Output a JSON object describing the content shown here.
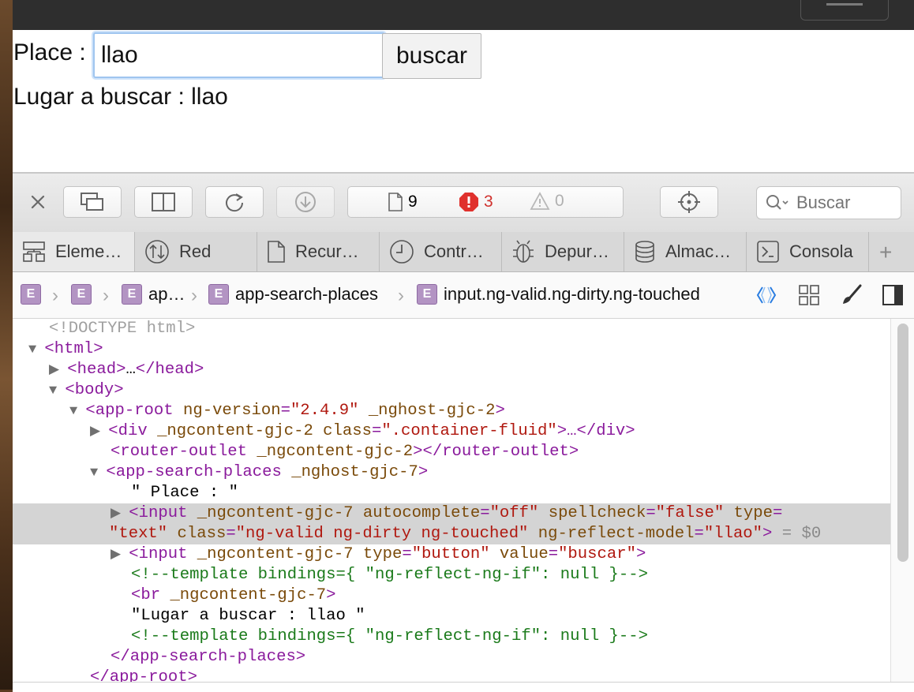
{
  "page": {
    "place_label": "Place :",
    "place_value": "llao",
    "search_button": "buscar",
    "result_text": "Lugar a buscar : llao"
  },
  "devtools": {
    "toolbar": {
      "counts": {
        "resources": "9",
        "errors": "3",
        "warnings": "0"
      },
      "search_placeholder": "Buscar"
    },
    "tabs": [
      {
        "label": "Eleme…",
        "icon": "elements-icon"
      },
      {
        "label": "Red",
        "icon": "network-icon"
      },
      {
        "label": "Recur…",
        "icon": "resources-icon"
      },
      {
        "label": "Contr…",
        "icon": "timelines-icon"
      },
      {
        "label": "Depur…",
        "icon": "debugger-icon"
      },
      {
        "label": "Almac…",
        "icon": "storage-icon"
      },
      {
        "label": "Consola",
        "icon": "console-icon"
      }
    ],
    "breadcrumbs": [
      {
        "badge": "E",
        "label": ""
      },
      {
        "badge": "E",
        "label": ""
      },
      {
        "badge": "E",
        "label": "ap…"
      },
      {
        "badge": "E",
        "label": "app-search-places"
      },
      {
        "badge": "E",
        "label": "input.ng-valid.ng-dirty.ng-touched"
      }
    ],
    "dom": {
      "doctype": "<!DOCTYPE html>",
      "html_open": "<html>",
      "head": "<head>",
      "head_ellipsis": "…",
      "head_close": "</head>",
      "body_open": "<body>",
      "app_root_tag": "<app-root",
      "app_root_attr1_name": "ng-version",
      "app_root_attr1_value": "\"2.4.9\"",
      "app_root_attr2_name": "_nghost-gjc-2",
      "app_root_close": ">",
      "div_tag": "<div",
      "div_attr1_name": "_ngcontent-gjc-2",
      "div_attr2_name": "class",
      "div_attr2_value": "\".container-fluid\"",
      "div_close": ">…</div>",
      "router_outlet_open": "<router-outlet",
      "router_outlet_attr": "_ngcontent-gjc-2",
      "router_outlet_close": "></router-outlet>",
      "app_search_tag": "<app-search-places",
      "app_search_attr": "_nghost-gjc-7",
      "app_search_close": ">",
      "text_place": "\" Place : \"",
      "input1_tag": "<input",
      "input1_a1": "_ngcontent-gjc-7",
      "input1_a2_name": "autocomplete",
      "input1_a2_val": "\"off\"",
      "input1_a3_name": "spellcheck",
      "input1_a3_val": "\"false\"",
      "input1_a4_name": "type",
      "input1_a4_val": "\"text\"",
      "input1_a5_name": "class",
      "input1_a5_val": "\"ng-valid ng-dirty ng-touched\"",
      "input1_a6_name": "ng-reflect-model",
      "input1_a6_val": "\"llao\"",
      "input1_close": ">",
      "input1_ref": "= $0",
      "input2_tag": "<input",
      "input2_a1": "_ngcontent-gjc-7",
      "input2_a2_name": "type",
      "input2_a2_val": "\"button\"",
      "input2_a3_name": "value",
      "input2_a3_val": "\"buscar\"",
      "input2_close": ">",
      "comment1": "<!--template bindings={ \"ng-reflect-ng-if\": null }-->",
      "br_tag": "<br",
      "br_attr": "_ngcontent-gjc-7",
      "br_close": ">",
      "text_lugar": "\"Lugar a buscar : llao \"",
      "comment2": "<!--template bindings={ \"ng-reflect-ng-if\": null }-->",
      "app_search_end": "</app-search-places>",
      "app_root_end": "</app-root>"
    }
  }
}
